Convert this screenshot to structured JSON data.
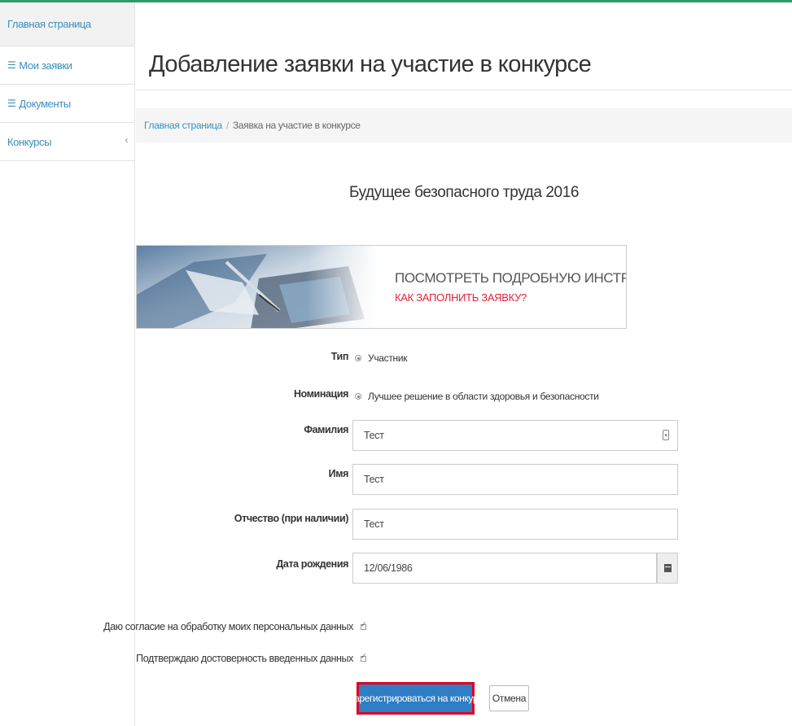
{
  "sidebar": {
    "items": [
      {
        "label": "Главная страница"
      },
      {
        "label": "Мои заявки"
      },
      {
        "label": "Документы"
      },
      {
        "label": "Конкурсы"
      }
    ]
  },
  "page": {
    "title": "Добавление заявки на участие в конкурсе"
  },
  "breadcrumb": {
    "home": "Главная страница",
    "separator": "/",
    "current": "Заявка на участие в конкурсе"
  },
  "contest": {
    "title": "Будущее безопасного труда 2016"
  },
  "banner": {
    "main_text": "ПОСМОТРЕТЬ ПОДРОБНУЮ ИНСТРУКЦИЮ",
    "sub_text": "КАК ЗАПОЛНИТЬ ЗАЯВКУ?",
    "sub_color": "#e2213a"
  },
  "form": {
    "type": {
      "label": "Тип",
      "value": "Участник"
    },
    "nomination": {
      "label": "Номинация",
      "value": "Лучшее решение в области здоровья и безопасности"
    },
    "last_name": {
      "label": "Фамилия",
      "value": "Тест"
    },
    "first_name": {
      "label": "Имя",
      "value": "Тест"
    },
    "patronymic": {
      "label": "Отчество (при наличии)",
      "value": "Тест"
    },
    "birth_date": {
      "label": "Дата рождения",
      "value": "12/06/1986"
    },
    "consent": {
      "label": "Даю согласие на обработку моих персональных данных",
      "checked": true
    },
    "confirm": {
      "label": "Подтверждаю достоверность введенных данных",
      "checked": true
    },
    "submit_label": "Зарегистрироваться на конкурс",
    "cancel_label": "Отмена"
  },
  "colors": {
    "accent": "#2e9a6a",
    "link": "#3c8dbc",
    "primary_button": "#2f7dc4",
    "highlight_border": "#e0001a"
  }
}
